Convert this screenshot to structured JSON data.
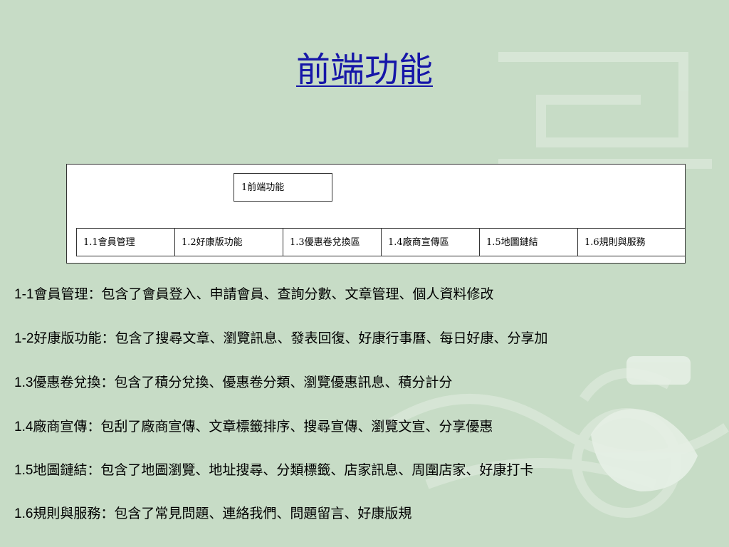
{
  "slide": {
    "title": "前端功能",
    "title_color": "#1616a8",
    "background_color": "#c7dcc6"
  },
  "diagram": {
    "root": "1前端功能",
    "children": [
      "1.1會員管理",
      "1.2好康版功能",
      "1.3優惠卷兌換區",
      "1.4廠商宣傳區",
      "1.5地圖鏈結",
      "1.6規則與服務"
    ]
  },
  "descriptions": [
    {
      "num": "1-1",
      "text": "會員管理：包含了會員登入、申請會員、查詢分數、文章管理、個人資料修改"
    },
    {
      "num": "1-2",
      "text": "好康版功能：包含了搜尋文章、瀏覽訊息、發表回復、好康行事曆、每日好康、分享加"
    },
    {
      "num": "1.3",
      "text": "優惠卷兌換：包含了積分兌換、優惠卷分類、瀏覽優惠訊息、積分計分"
    },
    {
      "num": "1.4",
      "text": "廠商宣傳：包刮了廠商宣傳、文章標籤排序、搜尋宣傳、瀏覽文宣、分享優惠"
    },
    {
      "num": "1.5",
      "text": "地圖鏈結：包含了地圖瀏覽、地址搜尋、分類標籤、店家訊息、周圍店家、好康打卡"
    },
    {
      "num": "1.6",
      "text": "規則與服務：包含了常見問題、連絡我們、問題留言、好康版規"
    }
  ]
}
